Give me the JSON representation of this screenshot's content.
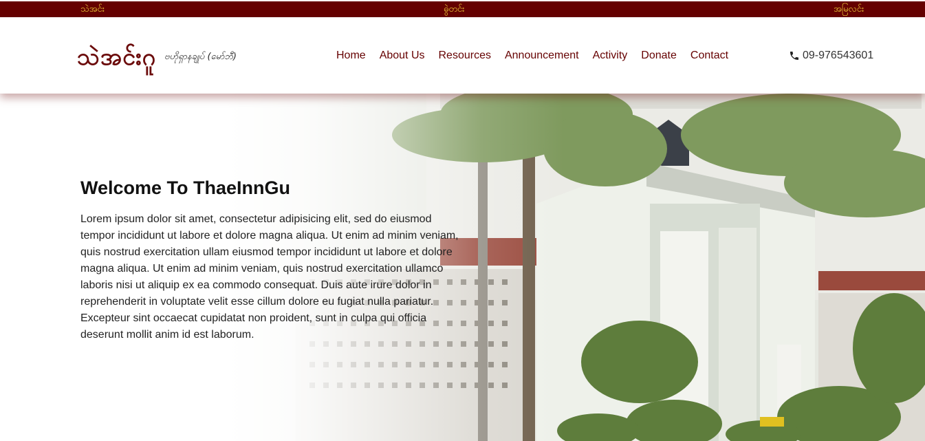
{
  "topbar": {
    "left_link": "သဲအင်း",
    "middle_link": "ဓွဲတင်း",
    "right_link": "အမြလင်း"
  },
  "brand": {
    "title": "သဲအင်းဂူ",
    "subtitle": "ဗဟိုရှာနချုပ် (မော်ဘီ)"
  },
  "nav": {
    "items": [
      "Home",
      "About Us",
      "Resources",
      "Announcement",
      "Activity",
      "Donate",
      "Contact"
    ]
  },
  "contact": {
    "phone": "09-976543601",
    "phone_icon": "phone-icon"
  },
  "hero": {
    "title": "Welcome To ThaeInnGu",
    "text": "Lorem ipsum dolor sit amet, consectetur adipisicing elit, sed do eiusmod tempor incididunt ut labore et dolore magna aliqua. Ut enim ad minim veniam, quis nostrud exercitation ullam eiusmod tempor incididunt ut labore et dolore magna aliqua. Ut enim ad minim veniam, quis nostrud exercitation ullamco laboris nisi ut aliquip ex ea commodo consequat. Duis aute irure dolor in reprehenderit in voluptate velit esse cillum dolore eu fugiat nulla pariatur. Excepteur sint occaecat cupidatat non proident, sunt in culpa qui officia deserunt mollit anim id est laborum."
  },
  "colors": {
    "primary": "#650000",
    "topbar_text": "#f2d23a",
    "nav_text": "#650000"
  }
}
